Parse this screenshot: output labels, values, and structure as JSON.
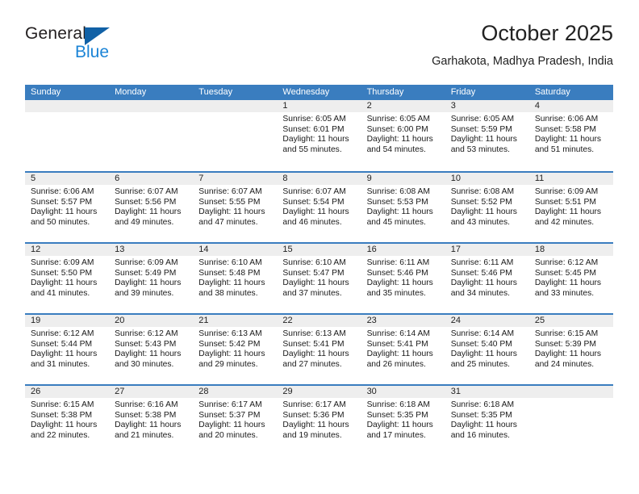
{
  "brand": {
    "name_top": "General",
    "name_bottom": "Blue",
    "accent_blue": "#1b84d6",
    "triangle_blue": "#1161a6"
  },
  "header": {
    "title": "October 2025",
    "location": "Garhakota, Madhya Pradesh, India"
  },
  "calendar": {
    "header_bg": "#3a7dbf",
    "daynum_bg": "#eeeeee",
    "weekdays": [
      "Sunday",
      "Monday",
      "Tuesday",
      "Wednesday",
      "Thursday",
      "Friday",
      "Saturday"
    ],
    "weeks": [
      [
        {
          "day": "",
          "sunrise": "",
          "sunset": "",
          "daylight1": "",
          "daylight2": ""
        },
        {
          "day": "",
          "sunrise": "",
          "sunset": "",
          "daylight1": "",
          "daylight2": ""
        },
        {
          "day": "",
          "sunrise": "",
          "sunset": "",
          "daylight1": "",
          "daylight2": ""
        },
        {
          "day": "1",
          "sunrise": "Sunrise: 6:05 AM",
          "sunset": "Sunset: 6:01 PM",
          "daylight1": "Daylight: 11 hours",
          "daylight2": "and 55 minutes."
        },
        {
          "day": "2",
          "sunrise": "Sunrise: 6:05 AM",
          "sunset": "Sunset: 6:00 PM",
          "daylight1": "Daylight: 11 hours",
          "daylight2": "and 54 minutes."
        },
        {
          "day": "3",
          "sunrise": "Sunrise: 6:05 AM",
          "sunset": "Sunset: 5:59 PM",
          "daylight1": "Daylight: 11 hours",
          "daylight2": "and 53 minutes."
        },
        {
          "day": "4",
          "sunrise": "Sunrise: 6:06 AM",
          "sunset": "Sunset: 5:58 PM",
          "daylight1": "Daylight: 11 hours",
          "daylight2": "and 51 minutes."
        }
      ],
      [
        {
          "day": "5",
          "sunrise": "Sunrise: 6:06 AM",
          "sunset": "Sunset: 5:57 PM",
          "daylight1": "Daylight: 11 hours",
          "daylight2": "and 50 minutes."
        },
        {
          "day": "6",
          "sunrise": "Sunrise: 6:07 AM",
          "sunset": "Sunset: 5:56 PM",
          "daylight1": "Daylight: 11 hours",
          "daylight2": "and 49 minutes."
        },
        {
          "day": "7",
          "sunrise": "Sunrise: 6:07 AM",
          "sunset": "Sunset: 5:55 PM",
          "daylight1": "Daylight: 11 hours",
          "daylight2": "and 47 minutes."
        },
        {
          "day": "8",
          "sunrise": "Sunrise: 6:07 AM",
          "sunset": "Sunset: 5:54 PM",
          "daylight1": "Daylight: 11 hours",
          "daylight2": "and 46 minutes."
        },
        {
          "day": "9",
          "sunrise": "Sunrise: 6:08 AM",
          "sunset": "Sunset: 5:53 PM",
          "daylight1": "Daylight: 11 hours",
          "daylight2": "and 45 minutes."
        },
        {
          "day": "10",
          "sunrise": "Sunrise: 6:08 AM",
          "sunset": "Sunset: 5:52 PM",
          "daylight1": "Daylight: 11 hours",
          "daylight2": "and 43 minutes."
        },
        {
          "day": "11",
          "sunrise": "Sunrise: 6:09 AM",
          "sunset": "Sunset: 5:51 PM",
          "daylight1": "Daylight: 11 hours",
          "daylight2": "and 42 minutes."
        }
      ],
      [
        {
          "day": "12",
          "sunrise": "Sunrise: 6:09 AM",
          "sunset": "Sunset: 5:50 PM",
          "daylight1": "Daylight: 11 hours",
          "daylight2": "and 41 minutes."
        },
        {
          "day": "13",
          "sunrise": "Sunrise: 6:09 AM",
          "sunset": "Sunset: 5:49 PM",
          "daylight1": "Daylight: 11 hours",
          "daylight2": "and 39 minutes."
        },
        {
          "day": "14",
          "sunrise": "Sunrise: 6:10 AM",
          "sunset": "Sunset: 5:48 PM",
          "daylight1": "Daylight: 11 hours",
          "daylight2": "and 38 minutes."
        },
        {
          "day": "15",
          "sunrise": "Sunrise: 6:10 AM",
          "sunset": "Sunset: 5:47 PM",
          "daylight1": "Daylight: 11 hours",
          "daylight2": "and 37 minutes."
        },
        {
          "day": "16",
          "sunrise": "Sunrise: 6:11 AM",
          "sunset": "Sunset: 5:46 PM",
          "daylight1": "Daylight: 11 hours",
          "daylight2": "and 35 minutes."
        },
        {
          "day": "17",
          "sunrise": "Sunrise: 6:11 AM",
          "sunset": "Sunset: 5:46 PM",
          "daylight1": "Daylight: 11 hours",
          "daylight2": "and 34 minutes."
        },
        {
          "day": "18",
          "sunrise": "Sunrise: 6:12 AM",
          "sunset": "Sunset: 5:45 PM",
          "daylight1": "Daylight: 11 hours",
          "daylight2": "and 33 minutes."
        }
      ],
      [
        {
          "day": "19",
          "sunrise": "Sunrise: 6:12 AM",
          "sunset": "Sunset: 5:44 PM",
          "daylight1": "Daylight: 11 hours",
          "daylight2": "and 31 minutes."
        },
        {
          "day": "20",
          "sunrise": "Sunrise: 6:12 AM",
          "sunset": "Sunset: 5:43 PM",
          "daylight1": "Daylight: 11 hours",
          "daylight2": "and 30 minutes."
        },
        {
          "day": "21",
          "sunrise": "Sunrise: 6:13 AM",
          "sunset": "Sunset: 5:42 PM",
          "daylight1": "Daylight: 11 hours",
          "daylight2": "and 29 minutes."
        },
        {
          "day": "22",
          "sunrise": "Sunrise: 6:13 AM",
          "sunset": "Sunset: 5:41 PM",
          "daylight1": "Daylight: 11 hours",
          "daylight2": "and 27 minutes."
        },
        {
          "day": "23",
          "sunrise": "Sunrise: 6:14 AM",
          "sunset": "Sunset: 5:41 PM",
          "daylight1": "Daylight: 11 hours",
          "daylight2": "and 26 minutes."
        },
        {
          "day": "24",
          "sunrise": "Sunrise: 6:14 AM",
          "sunset": "Sunset: 5:40 PM",
          "daylight1": "Daylight: 11 hours",
          "daylight2": "and 25 minutes."
        },
        {
          "day": "25",
          "sunrise": "Sunrise: 6:15 AM",
          "sunset": "Sunset: 5:39 PM",
          "daylight1": "Daylight: 11 hours",
          "daylight2": "and 24 minutes."
        }
      ],
      [
        {
          "day": "26",
          "sunrise": "Sunrise: 6:15 AM",
          "sunset": "Sunset: 5:38 PM",
          "daylight1": "Daylight: 11 hours",
          "daylight2": "and 22 minutes."
        },
        {
          "day": "27",
          "sunrise": "Sunrise: 6:16 AM",
          "sunset": "Sunset: 5:38 PM",
          "daylight1": "Daylight: 11 hours",
          "daylight2": "and 21 minutes."
        },
        {
          "day": "28",
          "sunrise": "Sunrise: 6:17 AM",
          "sunset": "Sunset: 5:37 PM",
          "daylight1": "Daylight: 11 hours",
          "daylight2": "and 20 minutes."
        },
        {
          "day": "29",
          "sunrise": "Sunrise: 6:17 AM",
          "sunset": "Sunset: 5:36 PM",
          "daylight1": "Daylight: 11 hours",
          "daylight2": "and 19 minutes."
        },
        {
          "day": "30",
          "sunrise": "Sunrise: 6:18 AM",
          "sunset": "Sunset: 5:35 PM",
          "daylight1": "Daylight: 11 hours",
          "daylight2": "and 17 minutes."
        },
        {
          "day": "31",
          "sunrise": "Sunrise: 6:18 AM",
          "sunset": "Sunset: 5:35 PM",
          "daylight1": "Daylight: 11 hours",
          "daylight2": "and 16 minutes."
        },
        {
          "day": "",
          "sunrise": "",
          "sunset": "",
          "daylight1": "",
          "daylight2": ""
        }
      ]
    ]
  }
}
